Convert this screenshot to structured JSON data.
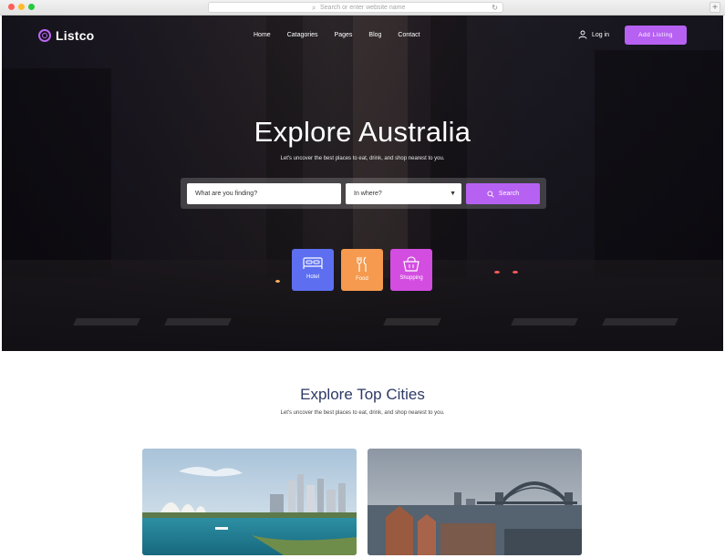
{
  "browser": {
    "url_placeholder": "Search or enter website name",
    "new_tab": "+"
  },
  "header": {
    "brand": "Listco",
    "nav": [
      "Home",
      "Catagories",
      "Pages",
      "Blog",
      "Contact"
    ],
    "login_label": "Log in",
    "add_listing_label": "Add Listing"
  },
  "hero": {
    "title": "Explore Australia",
    "subtitle": "Let's uncover the best places to eat, drink, and shop nearest to you."
  },
  "search": {
    "what_placeholder": "What are you finding?",
    "where_placeholder": "In where?",
    "button_label": "Search"
  },
  "categories": [
    {
      "label": "Hotel",
      "color": "#5d6ff0",
      "icon": "bed-icon"
    },
    {
      "label": "Food",
      "color": "#f59a4e",
      "icon": "fork-knife-icon"
    },
    {
      "label": "Shopping",
      "color": "#d24de0",
      "icon": "shopping-bag-icon"
    }
  ],
  "cities_section": {
    "title": "Explore Top Cities",
    "subtitle": "Let's uncover the best places to eat, drink, and shop nearest to you."
  },
  "colors": {
    "accent": "#b761f3",
    "section_title": "#2e3a66"
  }
}
